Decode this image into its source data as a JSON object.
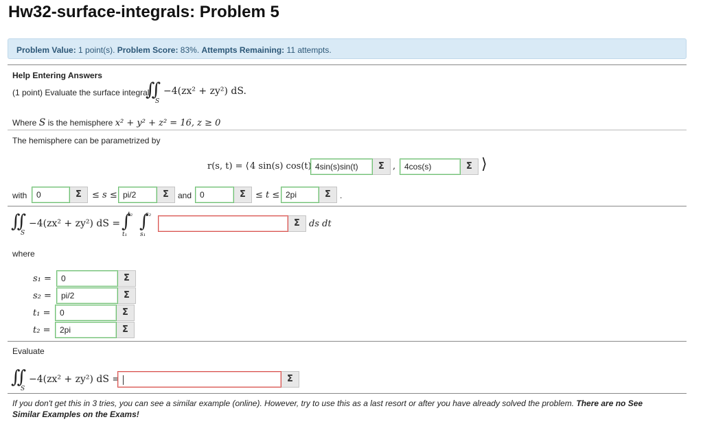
{
  "page_title": "Hw32-surface-integrals: Problem 5",
  "info": {
    "value_label": "Problem Value:",
    "value_text": "1 point(s).",
    "score_label": "Problem Score:",
    "score_text": "83%.",
    "attempts_label": "Attempts Remaining:",
    "attempts_text": "11 attempts."
  },
  "help_link": "Help Entering Answers",
  "intro": "(1 point) Evaluate the surface integral",
  "integrand_text": "−4(zx² + zy²)  dS.",
  "where_s_prefix": "Where",
  "where_s_var": "S",
  "where_s_mid": "is the hemisphere",
  "hemisphere_eq": "x² + y² + z² = 16,  z ≥ 0",
  "param_text": "The hemisphere can be parametrized by",
  "r_lhs": "r(s, t) = ⟨",
  "r_first": "4 sin(s) cos(t) ,",
  "r_comma": ",",
  "r_close": "⟩",
  "with_label": "with",
  "s_ineq": "≤ s ≤",
  "and_label": "and",
  "t_ineq": "≤ t ≤",
  "period": ".",
  "integral_lhs": "−4(zx² + zy²)  dS  =",
  "ds_dt": "ds dt",
  "where_label": "where",
  "labels": {
    "s1": "s₁ =",
    "s2": "s₂ =",
    "t1": "t₁ =",
    "t2": "t₂ ="
  },
  "limit_labels": {
    "t2": "t₂",
    "t1": "t₁",
    "s2": "s₂",
    "s1": "s₁"
  },
  "evaluate_label": "Evaluate",
  "final_lhs": "−4(zx² + zy²)  dS  =",
  "footer_text": "If you don't get this in 3 tries, you can see a similar example (online). However, try to use this as a last resort or after you have already solved the problem. ",
  "footer_bold": "There are no See Similar Examples on the Exams!",
  "inputs": {
    "r_second": "4sin(s)sin(t)",
    "r_third": "4cos(s)",
    "s_lower": "0",
    "s_upper": "pi/2",
    "t_lower": "0",
    "t_upper": "2pi",
    "integrand": "",
    "s1": "0",
    "s2": "pi/2",
    "t1": "0",
    "t2": "2pi",
    "final": ""
  },
  "sigma_glyph": "Σ",
  "integral_glyph": "∬",
  "integral_single": "∫",
  "surface_sub": "S",
  "colors": {
    "info_bg": "#d9eaf6",
    "info_text": "#2c5777",
    "correct": "#6fbf73",
    "incorrect": "#d9534f"
  }
}
